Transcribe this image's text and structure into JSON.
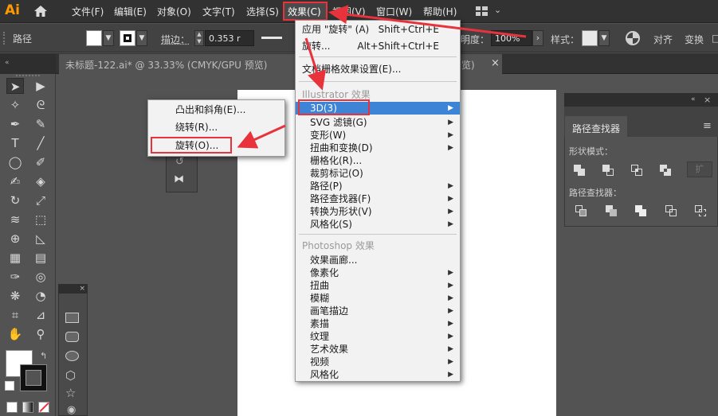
{
  "app": {
    "logo": "Ai"
  },
  "menubar": {
    "items": [
      "文件(F)",
      "编辑(E)",
      "对象(O)",
      "文字(T)",
      "选择(S)",
      "效果(C)",
      "视图(V)",
      "窗口(W)",
      "帮助(H)"
    ]
  },
  "control_bar": {
    "object_type": "路径",
    "stroke_label": "描边：",
    "stroke_value": "0.353 r",
    "opacity_label": "明度：",
    "opacity_value": "100%",
    "style_label": "样式：",
    "align_label": "对齐",
    "transform_label": "变换",
    "more_label": "□"
  },
  "document_tab": {
    "title": "未标题-122.ai* @ 33.33% (CMYK/GPU 预览)",
    "hidden_tail": "览)",
    "close": "×"
  },
  "effect_menu": {
    "apply_last": {
      "label": "应用 \"旋转\" (A)",
      "shortcut": "Shift+Ctrl+E"
    },
    "last_effect": {
      "label": "旋转...",
      "shortcut": "Alt+Shift+Ctrl+E"
    },
    "raster_settings": "文档栅格效果设置(E)...",
    "illustrator_heading": "Illustrator 效果",
    "illustrator_items": [
      "3D(3)",
      "SVG 滤镜(G)",
      "变形(W)",
      "扭曲和变换(D)",
      "栅格化(R)...",
      "裁剪标记(O)",
      "路径(P)",
      "路径查找器(F)",
      "转换为形状(V)",
      "风格化(S)"
    ],
    "photoshop_heading": "Photoshop 效果",
    "photoshop_items": [
      "效果画廊...",
      "像素化",
      "扭曲",
      "模糊",
      "画笔描边",
      "素描",
      "纹理",
      "艺术效果",
      "视频",
      "风格化"
    ]
  },
  "submenu_3d": {
    "items": [
      "凸出和斜角(E)...",
      "绕转(R)...",
      "旋转(O)..."
    ]
  },
  "pathfinder": {
    "title": "路径查找器",
    "shape_modes_label": "形状模式：",
    "expand_label": "扩",
    "pathfinders_label": "路径查找器："
  },
  "panel_close": "×",
  "tools_collapse": "«",
  "colors": {
    "accent_red": "#e8323c",
    "highlight_blue": "#3d84d6",
    "logo_orange": "#ff9a00"
  }
}
